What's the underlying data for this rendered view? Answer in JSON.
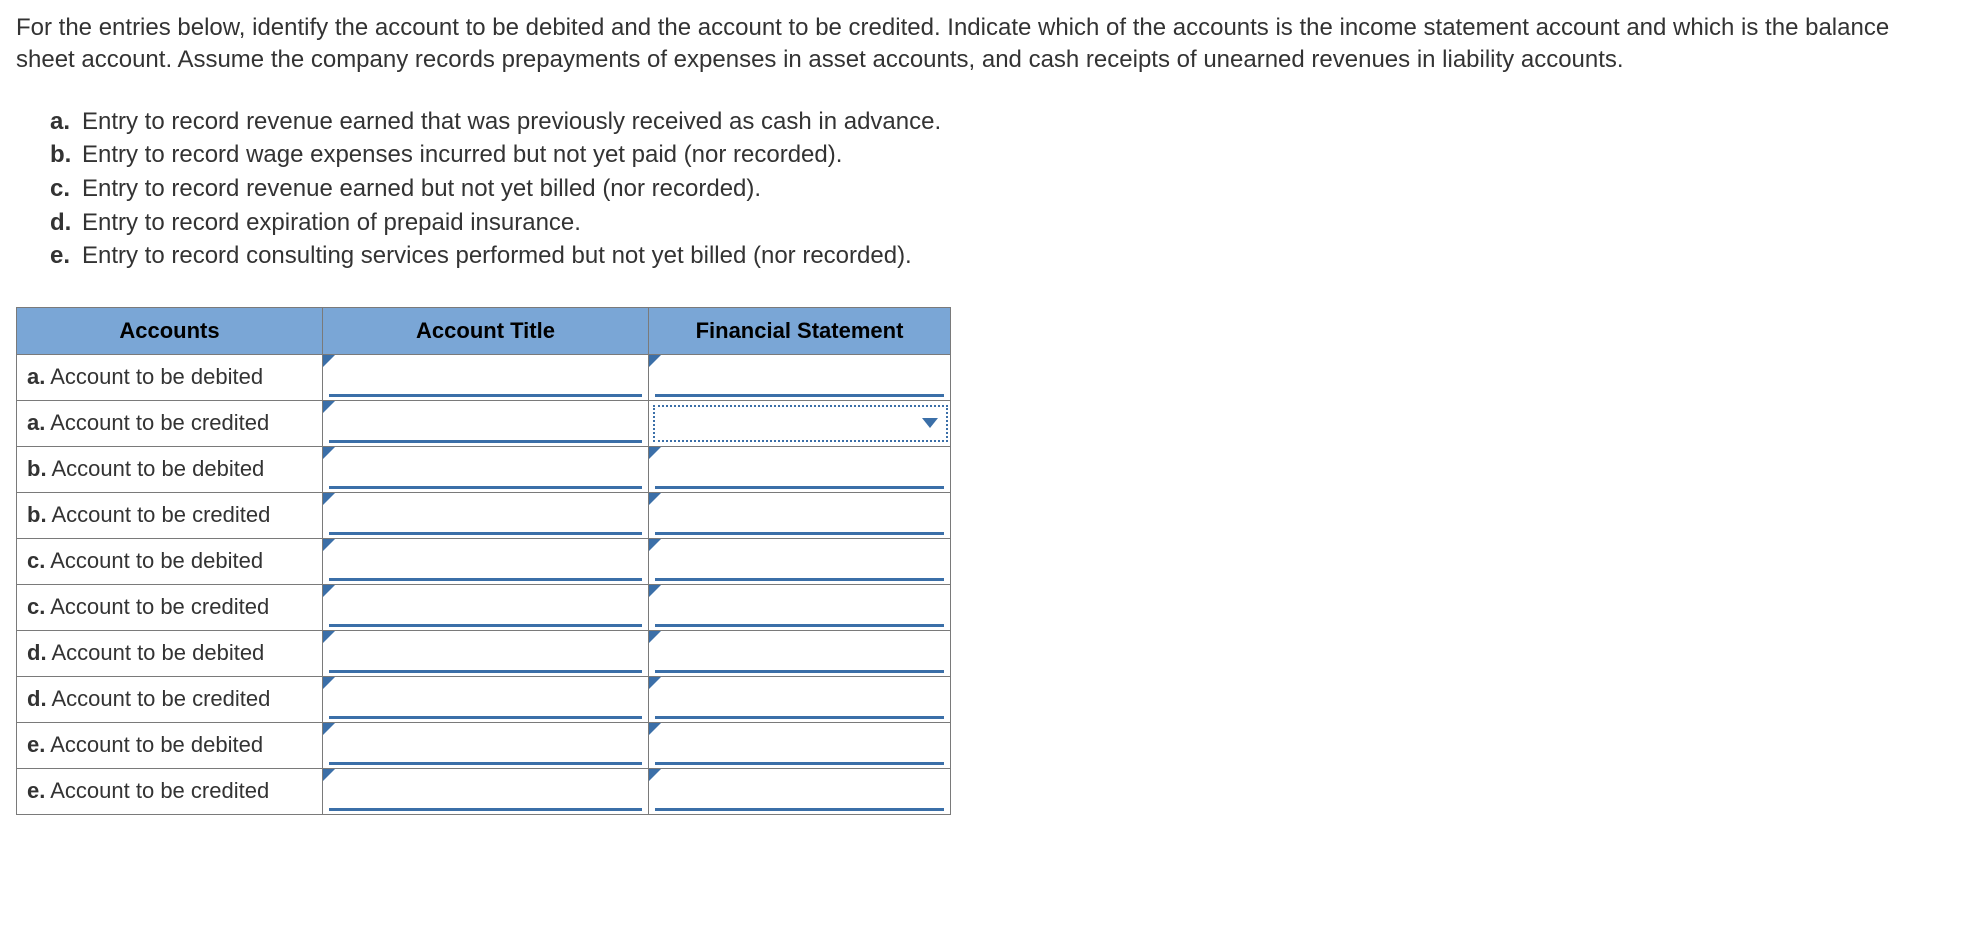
{
  "instructions": "For the entries below, identify the account to be debited and the account to be credited. Indicate which of the accounts is the income statement account and which is the balance sheet account. Assume the company records prepayments of expenses in asset accounts, and cash receipts of unearned revenues in liability accounts.",
  "entries": [
    {
      "letter": "a.",
      "text": "Entry to record revenue earned that was previously received as cash in advance."
    },
    {
      "letter": "b.",
      "text": "Entry to record wage expenses incurred but not yet paid (nor recorded)."
    },
    {
      "letter": "c.",
      "text": "Entry to record revenue earned but not yet billed (nor recorded)."
    },
    {
      "letter": "d.",
      "text": "Entry to record expiration of prepaid insurance."
    },
    {
      "letter": "e.",
      "text": "Entry to record consulting services performed but not yet billed (nor recorded)."
    }
  ],
  "table": {
    "headers": [
      "Accounts",
      "Account Title",
      "Financial Statement"
    ],
    "rows": [
      {
        "letter": "a.",
        "rest": " Account to be debited",
        "account_title": "",
        "financial_statement": "",
        "active": false
      },
      {
        "letter": "a.",
        "rest": " Account to be credited",
        "account_title": "",
        "financial_statement": "",
        "active": true
      },
      {
        "letter": "b.",
        "rest": " Account to be debited",
        "account_title": "",
        "financial_statement": "",
        "active": false
      },
      {
        "letter": "b.",
        "rest": " Account to be credited",
        "account_title": "",
        "financial_statement": "",
        "active": false
      },
      {
        "letter": "c.",
        "rest": " Account to be debited",
        "account_title": "",
        "financial_statement": "",
        "active": false
      },
      {
        "letter": "c.",
        "rest": " Account to be credited",
        "account_title": "",
        "financial_statement": "",
        "active": false
      },
      {
        "letter": "d.",
        "rest": " Account to be debited",
        "account_title": "",
        "financial_statement": "",
        "active": false
      },
      {
        "letter": "d.",
        "rest": " Account to be credited",
        "account_title": "",
        "financial_statement": "",
        "active": false
      },
      {
        "letter": "e.",
        "rest": " Account to be debited",
        "account_title": "",
        "financial_statement": "",
        "active": false
      },
      {
        "letter": "e.",
        "rest": " Account to be credited",
        "account_title": "",
        "financial_statement": "",
        "active": false
      }
    ]
  }
}
